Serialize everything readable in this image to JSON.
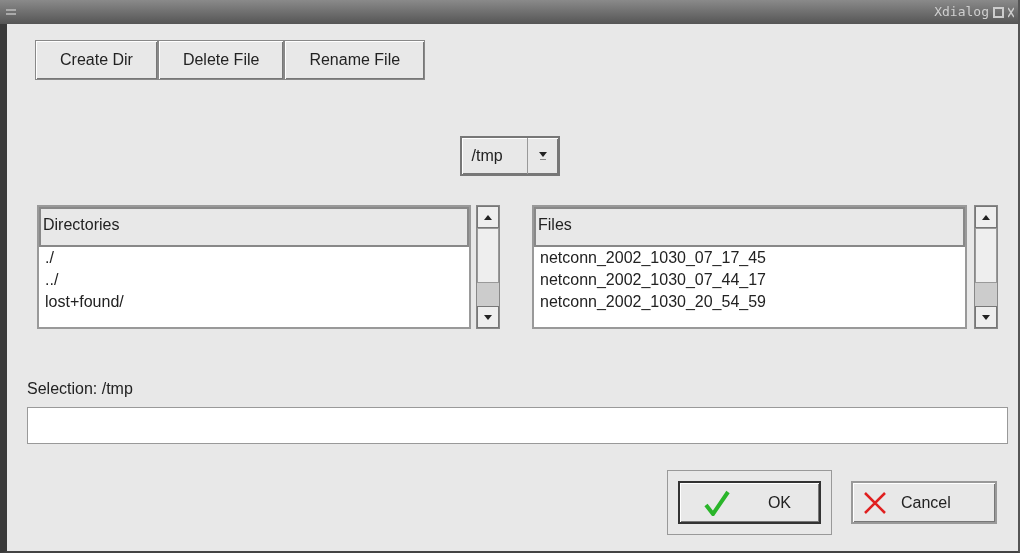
{
  "window": {
    "title": "Xdialog"
  },
  "toolbar": [
    "Create Dir",
    "Delete File",
    "Rename File"
  ],
  "directory_combo": {
    "value": "/tmp"
  },
  "directories": {
    "header": "Directories",
    "items": [
      "./",
      "../",
      "lost+found/"
    ]
  },
  "files": {
    "header": "Files",
    "items": [
      "netconn_2002_1030_07_17_45",
      "netconn_2002_1030_07_44_17",
      "netconn_2002_1030_20_54_59"
    ]
  },
  "selection": {
    "label": "Selection: /tmp"
  },
  "buttons": [
    {
      "kind": "ok",
      "label": "OK",
      "focused": true
    },
    {
      "kind": "cancel",
      "label": "Cancel",
      "focused": false
    }
  ]
}
